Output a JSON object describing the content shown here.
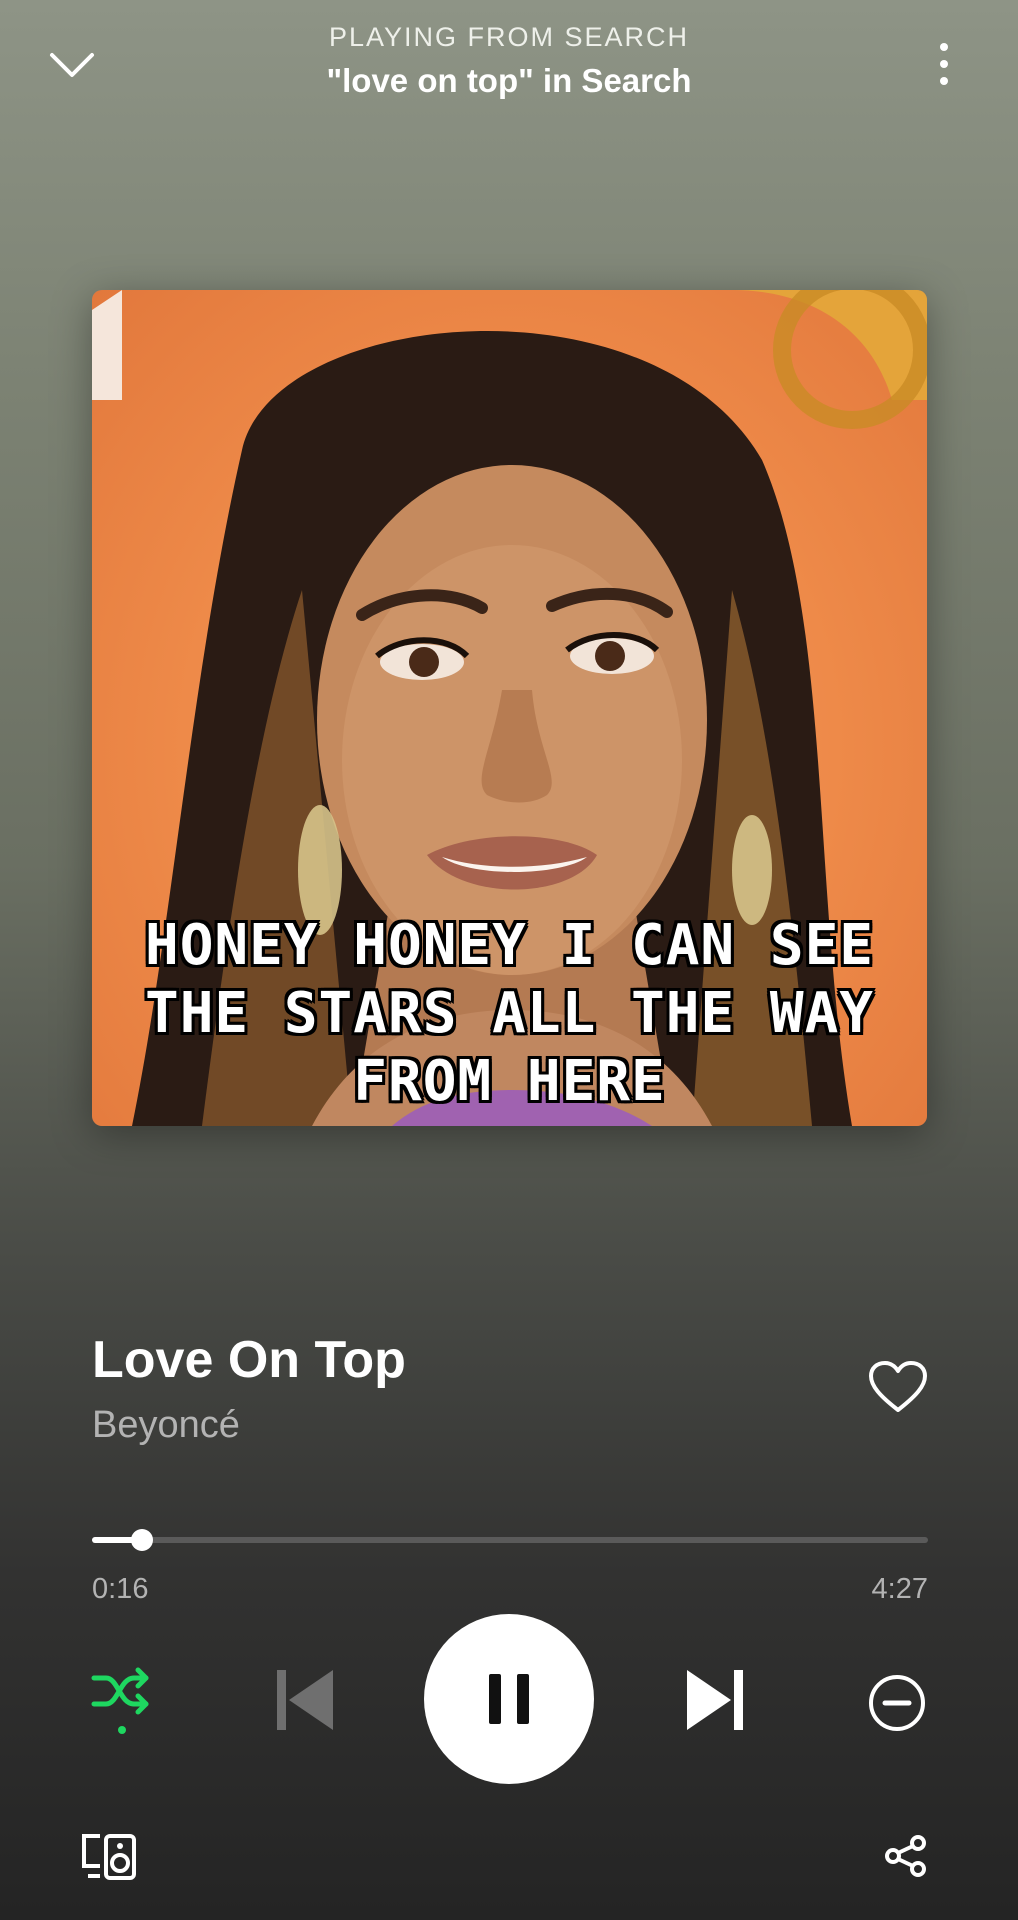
{
  "header": {
    "context_label": "PLAYING FROM SEARCH",
    "context_title": "\"love on top\" in Search"
  },
  "artwork": {
    "lyric": "HONEY HONEY I CAN SEE THE STARS ALL THE WAY FROM HERE",
    "background_color": "#ee8a49"
  },
  "track": {
    "title": "Love On Top",
    "artist": "Beyoncé"
  },
  "playback": {
    "elapsed": "0:16",
    "total": "4:27",
    "progress_fraction": 0.06,
    "state": "playing",
    "shuffle": true
  },
  "colors": {
    "accent": "#1ed760",
    "text_secondary": "#b3b3b3",
    "prev_disabled": "#6f6f6f"
  },
  "icons": {
    "collapse": "chevron-down-icon",
    "menu": "more-vertical-icon",
    "like": "heart-outline-icon",
    "shuffle": "shuffle-icon",
    "prev": "skip-previous-icon",
    "play": "pause-icon",
    "next": "skip-next-icon",
    "queue": "minus-circle-icon",
    "devices": "connect-devices-icon",
    "share": "share-icon"
  }
}
